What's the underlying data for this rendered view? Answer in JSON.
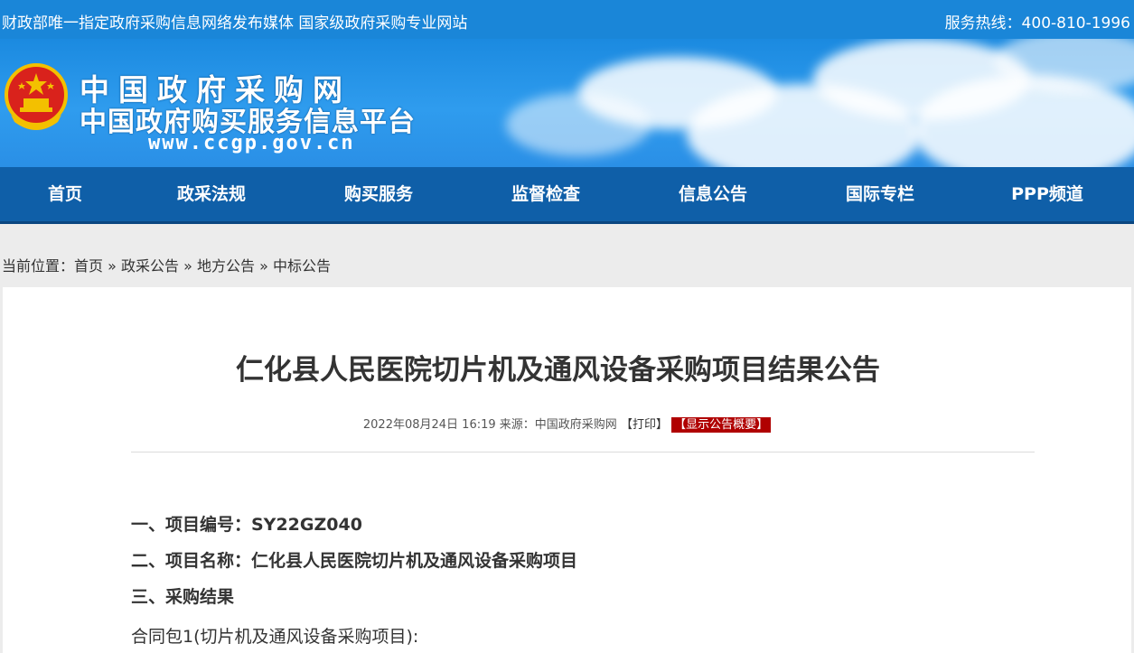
{
  "topbar": {
    "slogan": "财政部唯一指定政府采购信息网络发布媒体 国家级政府采购专业网站",
    "hotline": "服务热线：400-810-1996"
  },
  "brand": {
    "line1": "中国政府采购网",
    "line2": "中国政府购买服务信息平台",
    "url": "www.ccgp.gov.cn"
  },
  "nav": {
    "items": [
      {
        "label": "首页"
      },
      {
        "label": "政采法规"
      },
      {
        "label": "购买服务"
      },
      {
        "label": "监督检查"
      },
      {
        "label": "信息公告"
      },
      {
        "label": "国际专栏"
      },
      {
        "label": "PPP频道"
      }
    ]
  },
  "breadcrumb": {
    "prefix": "当前位置：",
    "items": [
      "首页",
      "政采公告",
      "地方公告",
      "中标公告"
    ],
    "separator": "»"
  },
  "article": {
    "title": "仁化县人民医院切片机及通风设备采购项目结果公告",
    "datetime": "2022年08月24日 16:19",
    "source": "来源：中国政府采购网",
    "print_label": "【打印】",
    "summary_label": "【显示公告概要】",
    "lines": [
      "一、项目编号：SY22GZ040",
      "二、项目名称：仁化县人民医院切片机及通风设备采购项目",
      "三、采购结果",
      "合同包1(切片机及通风设备采购项目):"
    ]
  },
  "colors": {
    "topbar": "#1a86d8",
    "nav": "#0f5fa8",
    "summary_badge": "#b00000"
  }
}
